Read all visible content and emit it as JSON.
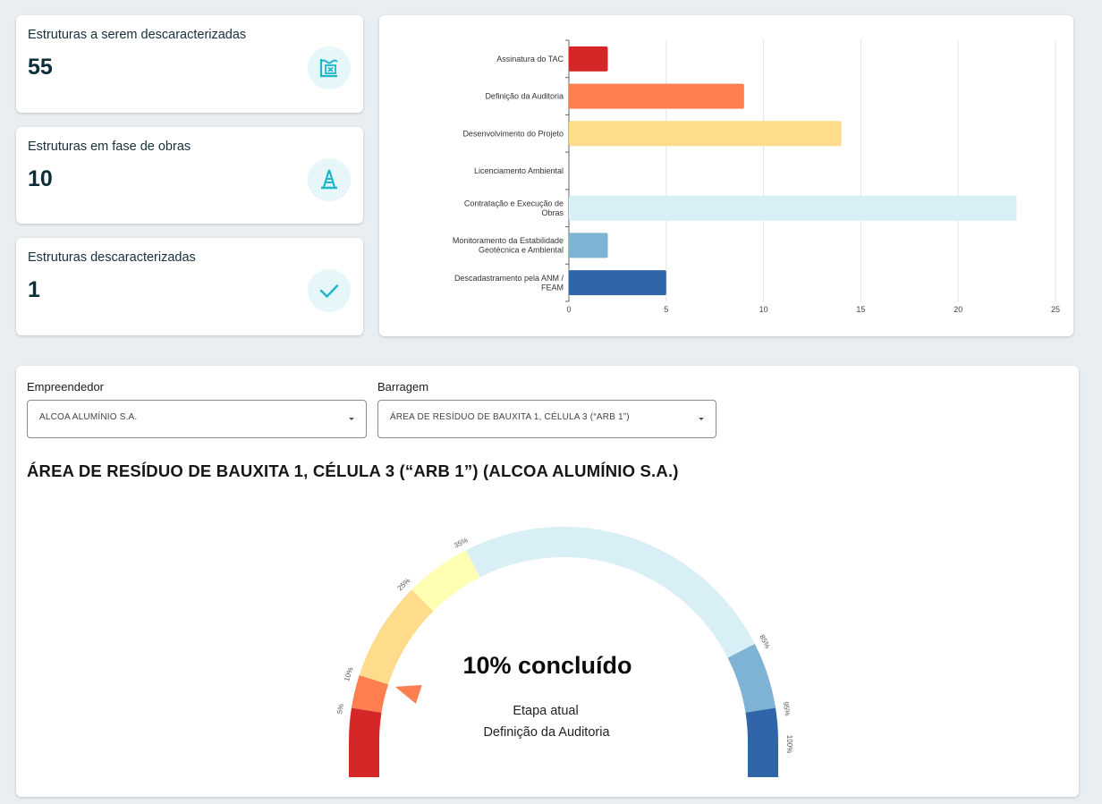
{
  "colors": {
    "accent": "#1fb6cc",
    "icon_bg": "#e6f6f9",
    "stages": [
      "#d62728",
      "#ff7f50",
      "#ffdb8c",
      "#ffffb3",
      "#d9eff6",
      "#7fb3d5",
      "#3066a9"
    ]
  },
  "stats": [
    {
      "title": "Estruturas a serem descaracterizadas",
      "value": "55",
      "icon": "dam-icon"
    },
    {
      "title": "Estruturas em fase de obras",
      "value": "10",
      "icon": "traffic-cone-icon"
    },
    {
      "title": "Estruturas descaracterizadas",
      "value": "1",
      "icon": "check-icon"
    }
  ],
  "chart_data": {
    "type": "bar",
    "orientation": "horizontal",
    "categories": [
      "Assinatura do TAC",
      "Definição da Auditoria",
      "Desenvolvimento do Projeto",
      "Licenciamento Ambiental",
      "Contratação e Execução de Obras",
      "Monitoramento da Estabilidade Geotécnica e Ambiental",
      "Descadastramento pela ANM / FEAM"
    ],
    "category_label_lines": [
      [
        "Assinatura do TAC"
      ],
      [
        "Definição da Auditoria"
      ],
      [
        "Desenvolvimento do Projeto"
      ],
      [
        "Licenciamento Ambiental"
      ],
      [
        "Contratação e Execução de",
        "Obras"
      ],
      [
        "Monitoramento da Estabilidade",
        "Geotécnica e Ambiental"
      ],
      [
        "Descadastramento pela ANM /",
        "FEAM"
      ]
    ],
    "values": [
      2,
      9,
      14,
      0,
      23,
      2,
      5
    ],
    "xlim": [
      0,
      25
    ],
    "xticks": [
      0,
      5,
      10,
      15,
      20,
      25
    ],
    "grid": true,
    "legend": "none"
  },
  "filters": {
    "empreendedor": {
      "label": "Empreendedor",
      "value": "ALCOA ALUMÍNIO S.A."
    },
    "barragem": {
      "label": "Barragem",
      "value": "ÁREA DE RESÍDUO DE BAUXITA 1, CÉLULA 3 (“ARB 1”)"
    }
  },
  "detail_title": "ÁREA DE RESÍDUO DE BAUXITA 1, CÉLULA 3 (“ARB 1”) (ALCOA ALUMÍNIO S.A.)",
  "gauge": {
    "progress_percent": 10,
    "completed_text": "10% concluído",
    "stage_caption": "Etapa atual",
    "stage_name": "Definição da Auditoria",
    "segment_bounds_percent": [
      0,
      5,
      10,
      25,
      35,
      85,
      95,
      100
    ],
    "tick_labels": [
      "5%",
      "10%",
      "25%",
      "35%",
      "85%",
      "95%",
      "100%"
    ]
  }
}
